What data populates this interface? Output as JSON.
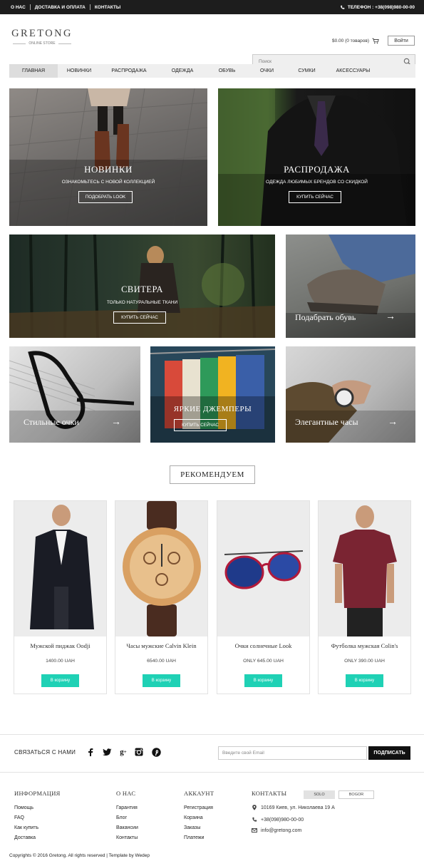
{
  "topbar": {
    "links": [
      "О НАС",
      "ДОСТАВКА И ОПЛАТА",
      "КОНТАКТЫ"
    ],
    "phone": "ТЕЛЕФОН : +38(098)980-00-00"
  },
  "header": {
    "logo_name": "GRETONG",
    "logo_sub": "ONLINE STORE",
    "cart": "$0.00 (0 товаров)",
    "login": "Войти",
    "search_placeholder": "Поиск"
  },
  "nav": [
    "ГЛАВНАЯ",
    "НОВИНКИ",
    "РАСПРОДАЖА",
    "ОДЕЖДА",
    "ОБУВЬ",
    "ОЧКИ",
    "СУМКИ",
    "АКСЕССУАРЫ"
  ],
  "banners": {
    "new": {
      "title": "НОВИНКИ",
      "subtitle": "ОЗНАКОМЬТЕСЬ С НОВОЙ КОЛЛЕКЦИЕЙ",
      "button": "ПОДОБРАТЬ LOOK"
    },
    "sale": {
      "title": "РАСПРОДАЖА",
      "subtitle": "ОДЕЖДА ЛЮБИМЫХ БРЕНДОВ СО СКИДКОЙ",
      "button": "КУПИТЬ СЕЙЧАС"
    },
    "sweaters": {
      "title": "СВИТЕРА",
      "subtitle": "ТОЛЬКО НАТУРАЛЬНЫЕ ТКАНИ",
      "button": "КУПИТЬ СЕЙЧАС"
    },
    "shoes": {
      "caption": "Подабрать обувь"
    },
    "glasses": {
      "caption": "Стильные очки"
    },
    "jumpers": {
      "title": "ЯРКИЕ ДЖЕМПЕРЫ",
      "button": "КУПИТЬ СЕЙЧАС"
    },
    "watches": {
      "caption": "Элегантные часы"
    }
  },
  "recommended": {
    "title": "РЕКОМЕНДУЕМ",
    "products": [
      {
        "name": "Мужской пиджак Oodji",
        "price": "1400.00 UAH",
        "button": "В корзину"
      },
      {
        "name": "Часы мужские Calvin Klein",
        "price": "6540.00 UAH",
        "button": "В корзину"
      },
      {
        "name": "Очки солнечные Look",
        "price": "ONLY 645.00 UAH",
        "button": "В корзину"
      },
      {
        "name": "Футболка мужская Colin's",
        "price": "ONLY 390.00 UAH",
        "button": "В корзину"
      }
    ]
  },
  "subscribe": {
    "label": "СВЯЗАТЬСЯ С НАМИ",
    "email_placeholder": "Введите свой Email",
    "button": "ПОДПИСАТЬ",
    "social": [
      "facebook-icon",
      "twitter-icon",
      "google-plus-icon",
      "instagram-icon",
      "pinterest-icon"
    ]
  },
  "footer": {
    "info": {
      "head": "ИНФОРМАЦИЯ",
      "links": [
        "Помощь",
        "FAQ",
        "Как купить",
        "Доставка"
      ]
    },
    "about": {
      "head": "О НАС",
      "links": [
        "Гарантия",
        "Блог",
        "Вакансии",
        "Контакты"
      ]
    },
    "account": {
      "head": "АККАУНТ",
      "links": [
        "Регистрация",
        "Корзина",
        "Заказы",
        "Платежи"
      ]
    },
    "contacts": {
      "head": "КОНТАКТЫ",
      "lang1": "SOLO",
      "lang2": "BOGOR",
      "address": "10169 Киев, ул. Николаева 19 А",
      "phone": "+38(098)980-00-00",
      "email": "info@gretong.com"
    },
    "copyright": "Copyrights © 2016 Gretong. All rights reserved | Template by Wedep"
  },
  "colors": {
    "accent": "#1fd1b5",
    "topbar": "#1d1d1d"
  }
}
